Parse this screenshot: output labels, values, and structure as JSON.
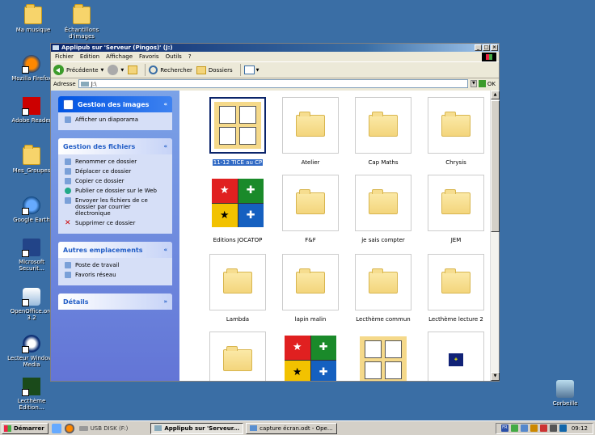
{
  "desktop": {
    "icons_left": [
      {
        "label": "Ma musique",
        "icon": "folder-music-icon"
      },
      {
        "label": "Mozilla Firefox",
        "icon": "firefox-icon"
      },
      {
        "label": "Adobe Reader",
        "icon": "adobe-reader-icon"
      },
      {
        "label": "Mes_Groupes",
        "icon": "folder-icon"
      },
      {
        "label": "Google Earth",
        "icon": "google-earth-icon"
      },
      {
        "label": "Microsoft Securit...",
        "icon": "security-icon"
      },
      {
        "label": "OpenOffice.org 3.2",
        "icon": "openoffice-icon"
      },
      {
        "label": "Lecteur Windows Media",
        "icon": "media-player-icon"
      },
      {
        "label": "Lecthème Edition...",
        "icon": "lectheme-icon"
      }
    ],
    "icon_top": {
      "label": "Échantillons d'images",
      "icon": "folder-images-icon"
    },
    "recycle": {
      "label": "Corbeille",
      "icon": "recycle-bin-icon"
    }
  },
  "window": {
    "title": "Applipub sur 'Serveur (Pingos)' (J:)",
    "controls": {
      "minimize": "_",
      "maximize": "□",
      "close": "×"
    },
    "menu": [
      "Fichier",
      "Edition",
      "Affichage",
      "Favoris",
      "Outils",
      "?"
    ],
    "toolbar": {
      "back": "Précédente",
      "search": "Rechercher",
      "folders": "Dossiers"
    },
    "address": {
      "label": "Adresse",
      "value": "J:\\",
      "go": "OK"
    },
    "panels": [
      {
        "title": "Gestion des images",
        "chevron": "«",
        "tasks": [
          "Afficher un diaporama"
        ]
      },
      {
        "title": "Gestion des fichiers",
        "chevron": "«",
        "tasks": [
          "Renommer ce dossier",
          "Déplacer ce dossier",
          "Copier ce dossier",
          "Publier ce dossier sur le Web",
          "Envoyer les fichiers de ce dossier par courrier électronique",
          "Supprimer ce dossier"
        ]
      },
      {
        "title": "Autres emplacements",
        "chevron": "«",
        "tasks": [
          "Poste de travail",
          "Favoris réseau"
        ]
      },
      {
        "title": "Détails",
        "chevron": "»"
      }
    ],
    "files": [
      {
        "name": "11-12 TICE au CP",
        "kind": "docs",
        "selected": true
      },
      {
        "name": "Atelier",
        "kind": "folder"
      },
      {
        "name": "Cap Maths",
        "kind": "folder"
      },
      {
        "name": "Chrysis",
        "kind": "folder"
      },
      {
        "name": "Editions JOCATOP",
        "kind": "quiz"
      },
      {
        "name": "F&F",
        "kind": "folder"
      },
      {
        "name": "je sais compter",
        "kind": "folder"
      },
      {
        "name": "JEM",
        "kind": "folder"
      },
      {
        "name": "Lambda",
        "kind": "folder"
      },
      {
        "name": "lapin malin",
        "kind": "folder"
      },
      {
        "name": "Lecthème commun",
        "kind": "folder"
      },
      {
        "name": "Lecthème lecture 2",
        "kind": "folder"
      },
      {
        "name": "",
        "kind": "folder"
      },
      {
        "name": "",
        "kind": "quiz"
      },
      {
        "name": "",
        "kind": "docs"
      },
      {
        "name": "",
        "kind": "lect"
      }
    ]
  },
  "taskbar": {
    "start": "Démarrer",
    "usb": "USB DISK (F:)",
    "items": [
      "Applipub sur 'Serveur...",
      "capture écran.odt - Ope..."
    ],
    "clock": "09:12",
    "lang": "FR"
  }
}
